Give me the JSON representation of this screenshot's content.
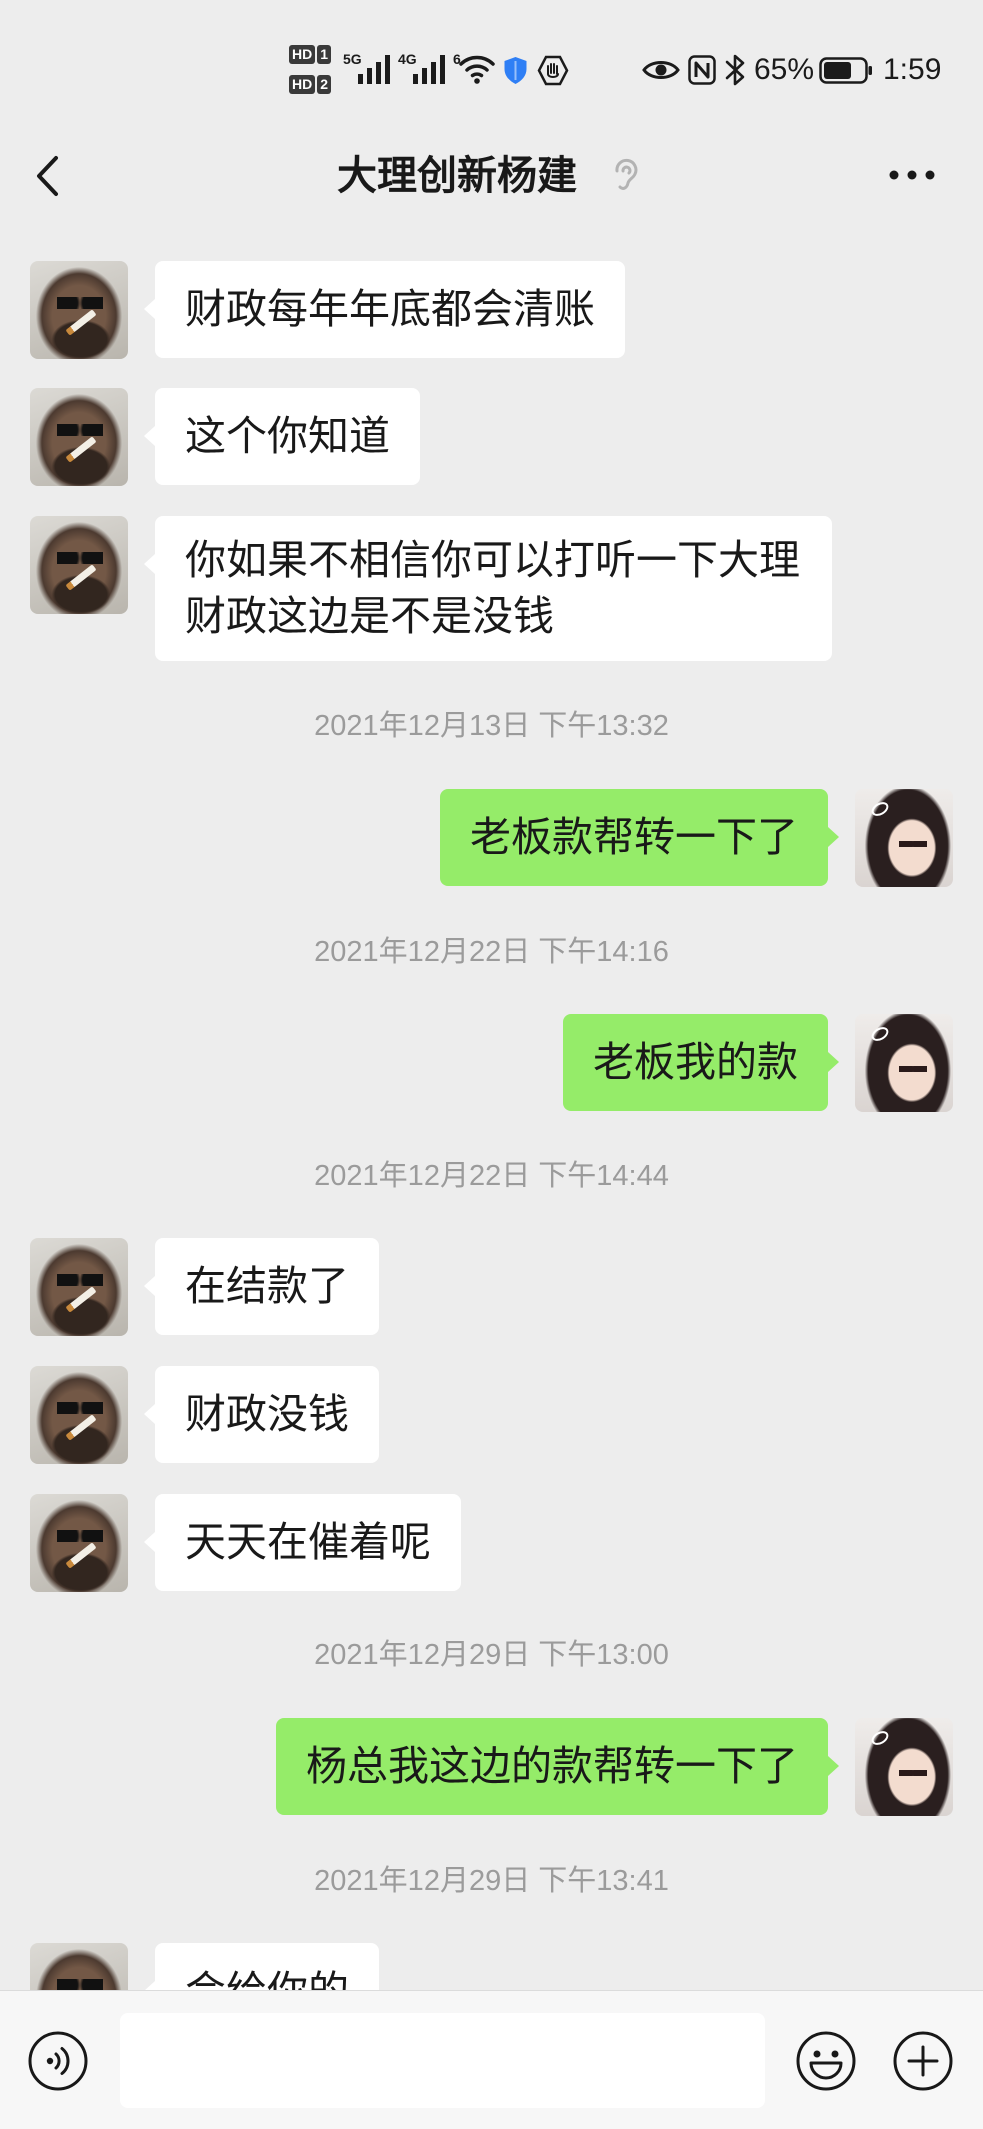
{
  "colors": {
    "page_background": "#EDEDED",
    "bubble_received": "#FFFFFF",
    "bubble_sent": "#95EC69",
    "timestamp_text": "#9B9B9B",
    "input_bar_background": "#F7F7F7"
  },
  "status_bar": {
    "volte_1": "HD",
    "sim_1": "1",
    "volte_2": "HD",
    "sim_2": "2",
    "network_1": "5G",
    "network_2": "4G",
    "wifi_standard": "6",
    "icons": [
      "signal-icon",
      "wifi-icon",
      "shield-icon",
      "hand-hexagon-icon",
      "eye-icon",
      "nfc-icon",
      "bluetooth-icon",
      "battery-icon"
    ],
    "battery_percent": "65%",
    "battery_level": 0.65,
    "time": "1:59"
  },
  "header": {
    "title": "大理创新杨建",
    "back_icon": "chevron-left-icon",
    "earpiece_icon": "earpiece-icon",
    "more_icon": "more-dots-icon"
  },
  "chat": [
    {
      "kind": "message",
      "side": "received",
      "text": "财政每年年底都会清账"
    },
    {
      "kind": "message",
      "side": "received",
      "text": "这个你知道"
    },
    {
      "kind": "message",
      "side": "received",
      "text": "你如果不相信你可以打听一下大理财政这边是不是没钱"
    },
    {
      "kind": "time",
      "text": "2021年12月13日 下午13:32"
    },
    {
      "kind": "message",
      "side": "sent",
      "text": "老板款帮转一下了"
    },
    {
      "kind": "time",
      "text": "2021年12月22日 下午14:16"
    },
    {
      "kind": "message",
      "side": "sent",
      "text": "老板我的款"
    },
    {
      "kind": "time",
      "text": "2021年12月22日 下午14:44"
    },
    {
      "kind": "message",
      "side": "received",
      "text": "在结款了"
    },
    {
      "kind": "message",
      "side": "received",
      "text": "财政没钱"
    },
    {
      "kind": "message",
      "side": "received",
      "text": "天天在催着呢"
    },
    {
      "kind": "time",
      "text": "2021年12月29日 下午13:00"
    },
    {
      "kind": "message",
      "side": "sent",
      "text": "杨总我这边的款帮转一下了"
    },
    {
      "kind": "time",
      "text": "2021年12月29日 下午13:41"
    },
    {
      "kind": "message",
      "side": "received",
      "text": "会给你的"
    }
  ],
  "input_bar": {
    "voice_icon": "voice-icon",
    "input_value": "",
    "emoji_icon": "emoji-icon",
    "more_icon": "plus-icon"
  }
}
